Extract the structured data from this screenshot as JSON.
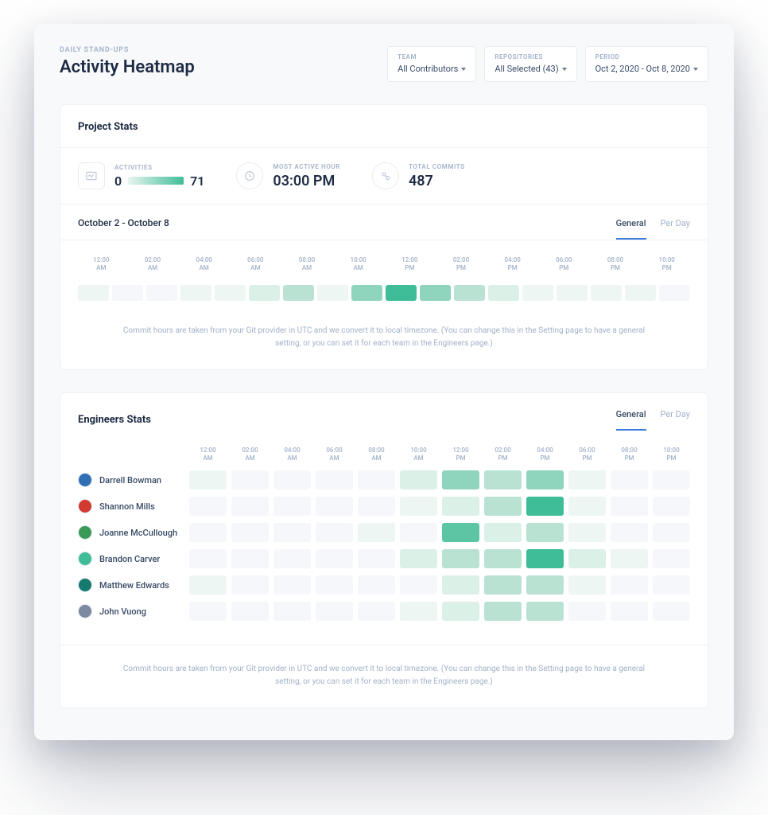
{
  "breadcrumb": "DAILY STAND-UPS",
  "page_title": "Activity Heatmap",
  "filters": {
    "team": {
      "label": "TEAM",
      "value": "All Contributors"
    },
    "repos": {
      "label": "REPOSITORIES",
      "value": "All Selected (43)"
    },
    "period": {
      "label": "PERIOD",
      "value": "Oct 2, 2020 - Oct 8, 2020"
    }
  },
  "project_stats": {
    "title": "Project Stats",
    "activities": {
      "label": "ACTIVITIES",
      "min": "0",
      "max": "71"
    },
    "most_active": {
      "label": "MOST ACTIVE HOUR",
      "value": "03:00 PM"
    },
    "total_commits": {
      "label": "TOTAL COMMITS",
      "value": "487"
    },
    "date_range": "October 2 - October 8",
    "tabs": {
      "general": "General",
      "per_day": "Per Day"
    }
  },
  "time_headers": [
    {
      "t": "12:00",
      "m": "AM"
    },
    {
      "t": "02:00",
      "m": "AM"
    },
    {
      "t": "04:00",
      "m": "AM"
    },
    {
      "t": "06:00",
      "m": "AM"
    },
    {
      "t": "08:00",
      "m": "AM"
    },
    {
      "t": "10:00",
      "m": "AM"
    },
    {
      "t": "12:00",
      "m": "PM"
    },
    {
      "t": "02:00",
      "m": "PM"
    },
    {
      "t": "04:00",
      "m": "PM"
    },
    {
      "t": "06:00",
      "m": "PM"
    },
    {
      "t": "08:00",
      "m": "PM"
    },
    {
      "t": "10:00",
      "m": "PM"
    }
  ],
  "chart_data": {
    "type": "heatmap",
    "intensity_range": [
      0,
      6
    ],
    "project_row": [
      1,
      0,
      0,
      1,
      1,
      2,
      3,
      1,
      4,
      6,
      4,
      3,
      2,
      1,
      1,
      1,
      1,
      0
    ],
    "project_slot_count": 18,
    "engineers_slot_count": 12,
    "engineers": [
      {
        "name": "Darrell Bowman",
        "avatar_color": "#2f6fb3",
        "row": [
          1,
          0,
          0,
          0,
          0,
          2,
          4,
          3,
          4,
          1,
          0,
          0
        ]
      },
      {
        "name": "Shannon Mills",
        "avatar_color": "#d33a2f",
        "row": [
          0,
          0,
          0,
          0,
          0,
          1,
          2,
          3,
          6,
          1,
          0,
          0
        ]
      },
      {
        "name": "Joanne McCullough",
        "avatar_color": "#3a9a55",
        "row": [
          0,
          0,
          0,
          0,
          1,
          0,
          5,
          2,
          3,
          1,
          0,
          0
        ]
      },
      {
        "name": "Brandon Carver",
        "avatar_color": "#3fbd98",
        "row": [
          0,
          0,
          0,
          0,
          0,
          2,
          3,
          3,
          6,
          2,
          1,
          0
        ]
      },
      {
        "name": "Matthew Edwards",
        "avatar_color": "#167a6f",
        "row": [
          1,
          0,
          0,
          0,
          0,
          0,
          2,
          3,
          3,
          1,
          0,
          0
        ]
      },
      {
        "name": "John Vuong",
        "avatar_color": "#7b8aa0",
        "row": [
          0,
          0,
          0,
          0,
          0,
          1,
          2,
          3,
          3,
          0,
          0,
          0
        ]
      }
    ]
  },
  "engineers_stats": {
    "title": "Engineers Stats",
    "tabs": {
      "general": "General",
      "per_day": "Per Day"
    }
  },
  "footnote": "Commit hours are taken from your Git provider in UTC and we convert it to local timezone. (You can change this in the Setting page to have a general setting, or you can set it for each team in the Engineers page.)"
}
